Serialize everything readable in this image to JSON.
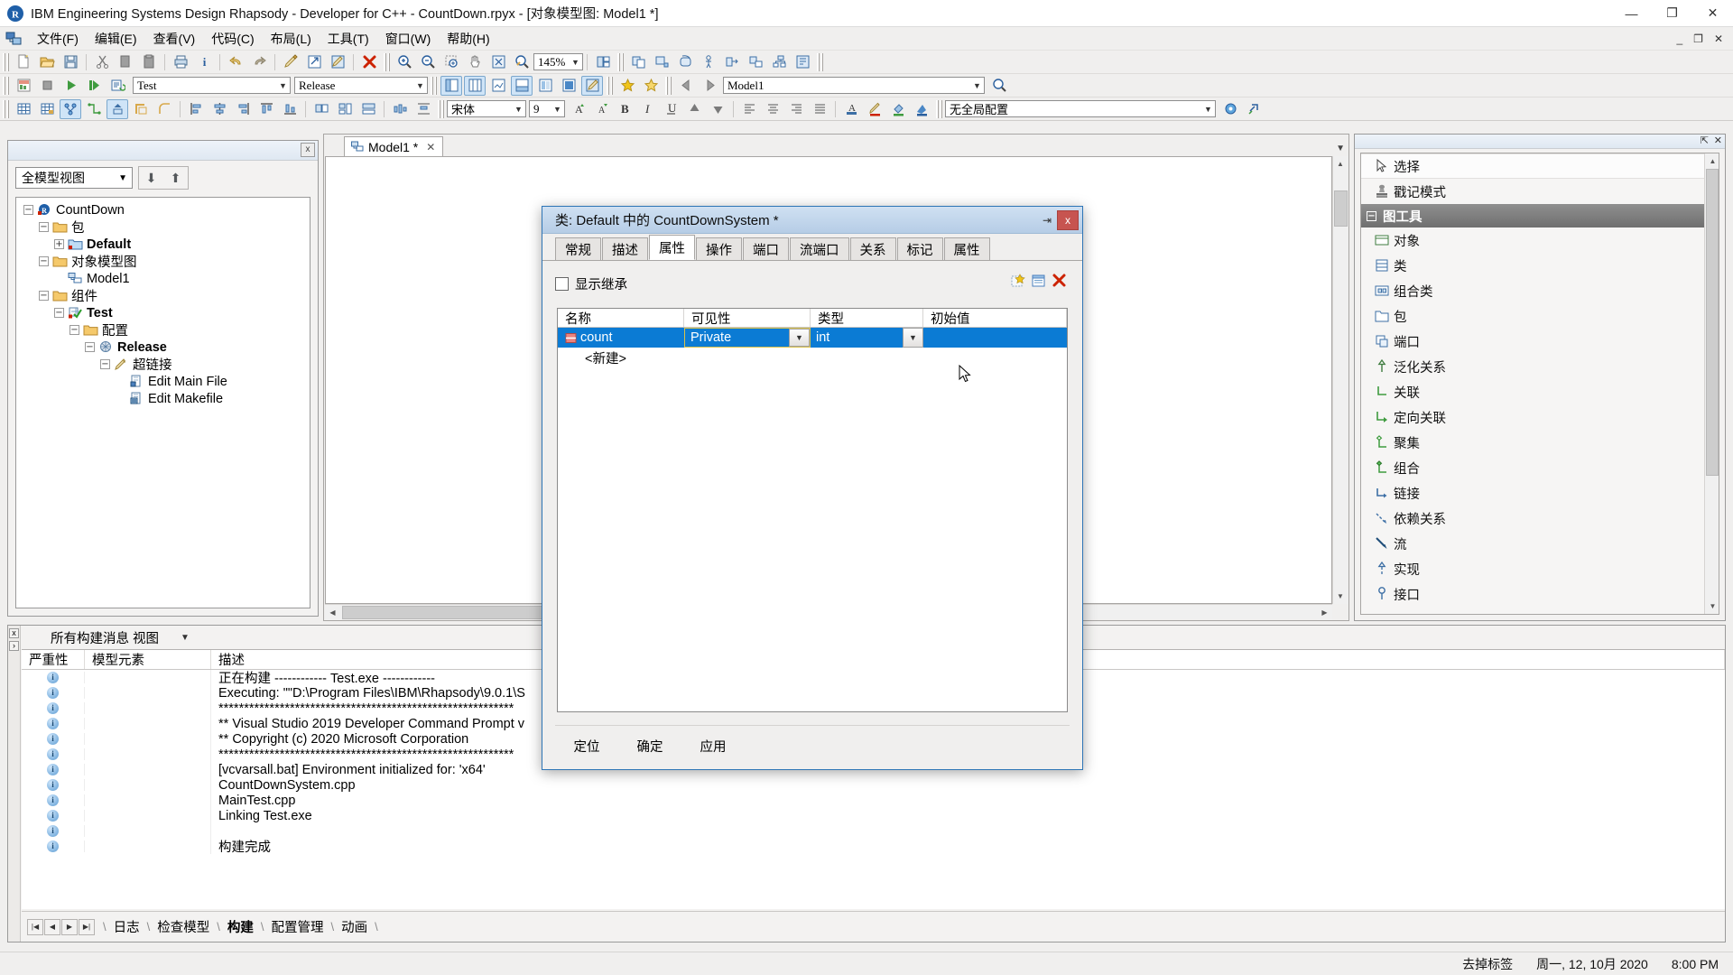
{
  "window": {
    "title": "IBM Engineering Systems Design Rhapsody - Developer for C++ - CountDown.rpyx - [对象模型图: Model1 *]",
    "minimize": "—",
    "restore": "❐",
    "close": "✕",
    "inner_minimize": "_",
    "inner_restore": "❐",
    "inner_close": "✕"
  },
  "menu": {
    "items": [
      {
        "label": "文件(F)"
      },
      {
        "label": "编辑(E)"
      },
      {
        "label": "查看(V)"
      },
      {
        "label": "代码(C)"
      },
      {
        "label": "布局(L)"
      },
      {
        "label": "工具(T)"
      },
      {
        "label": "窗口(W)"
      },
      {
        "label": "帮助(H)"
      }
    ]
  },
  "toolbar": {
    "zoom_level": "145%",
    "config_combo": "Test",
    "build_combo": "Release",
    "model_combo": "Model1",
    "font_name": "宋体",
    "font_size": "9",
    "global_config": "无全局配置"
  },
  "left_panel": {
    "view_selector": "全模型视图",
    "close": "x",
    "tree": [
      {
        "depth": 0,
        "label": "CountDown",
        "toggle": "−",
        "icon": "rhapsody-project-icon",
        "bold": false
      },
      {
        "depth": 1,
        "label": "包",
        "toggle": "−",
        "icon": "folder-icon",
        "bold": false
      },
      {
        "depth": 2,
        "label": "Default",
        "toggle": "+",
        "icon": "package-icon",
        "bold": true
      },
      {
        "depth": 1,
        "label": "对象模型图",
        "toggle": "−",
        "icon": "folder-icon",
        "bold": false
      },
      {
        "depth": 2,
        "label": "Model1",
        "toggle": "",
        "icon": "diagram-icon",
        "bold": false
      },
      {
        "depth": 1,
        "label": "组件",
        "toggle": "−",
        "icon": "folder-icon",
        "bold": false
      },
      {
        "depth": 2,
        "label": "Test",
        "toggle": "−",
        "icon": "component-icon",
        "bold": true
      },
      {
        "depth": 3,
        "label": "配置",
        "toggle": "−",
        "icon": "folder-icon",
        "bold": false
      },
      {
        "depth": 4,
        "label": "Release",
        "toggle": "−",
        "icon": "config-icon",
        "bold": true
      },
      {
        "depth": 5,
        "label": "超链接",
        "toggle": "−",
        "icon": "hyperlink-icon",
        "bold": false
      },
      {
        "depth": 6,
        "label": "Edit Main File",
        "toggle": "",
        "icon": "file-icon",
        "bold": false
      },
      {
        "depth": 6,
        "label": "Edit Makefile",
        "toggle": "",
        "icon": "makefile-icon",
        "bold": false
      }
    ]
  },
  "mdi": {
    "tab_label": "Model1 *",
    "tab_close": "✕"
  },
  "right_panel": {
    "pin": "⇱",
    "close": "✕",
    "items": [
      {
        "label": "选择",
        "icon": "arrow-cursor-icon",
        "selected": true,
        "group": false
      },
      {
        "label": "戳记模式",
        "icon": "stamp-icon",
        "selected": false,
        "group": false
      },
      {
        "label": "图工具",
        "icon": "",
        "selected": false,
        "group": true,
        "toggle": "−"
      },
      {
        "label": "对象",
        "icon": "object-icon",
        "selected": false,
        "group": false
      },
      {
        "label": "类",
        "icon": "class-icon",
        "selected": false,
        "group": false
      },
      {
        "label": "组合类",
        "icon": "composite-class-icon",
        "selected": false,
        "group": false
      },
      {
        "label": "包",
        "icon": "package-icon",
        "selected": false,
        "group": false
      },
      {
        "label": "端口",
        "icon": "port-icon",
        "selected": false,
        "group": false
      },
      {
        "label": "泛化关系",
        "icon": "generalization-icon",
        "selected": false,
        "group": false
      },
      {
        "label": "关联",
        "icon": "association-icon",
        "selected": false,
        "group": false
      },
      {
        "label": "定向关联",
        "icon": "directed-association-icon",
        "selected": false,
        "group": false
      },
      {
        "label": "聚集",
        "icon": "aggregation-icon",
        "selected": false,
        "group": false
      },
      {
        "label": "组合",
        "icon": "composition-icon",
        "selected": false,
        "group": false
      },
      {
        "label": "链接",
        "icon": "link-icon",
        "selected": false,
        "group": false
      },
      {
        "label": "依赖关系",
        "icon": "dependency-icon",
        "selected": false,
        "group": false
      },
      {
        "label": "流",
        "icon": "flow-icon",
        "selected": false,
        "group": false
      },
      {
        "label": "实现",
        "icon": "realization-icon",
        "selected": false,
        "group": false
      },
      {
        "label": "接口",
        "icon": "interface-icon",
        "selected": false,
        "group": false
      }
    ]
  },
  "dialog": {
    "title": "类: Default 中的 CountDownSystem *",
    "pin": "⇥",
    "close": "x",
    "tabs": [
      {
        "label": "常规",
        "selected": false
      },
      {
        "label": "描述",
        "selected": false
      },
      {
        "label": "属性",
        "selected": true
      },
      {
        "label": "操作",
        "selected": false
      },
      {
        "label": "端口",
        "selected": false
      },
      {
        "label": "流端口",
        "selected": false
      },
      {
        "label": "关系",
        "selected": false
      },
      {
        "label": "标记",
        "selected": false
      },
      {
        "label": "属性",
        "selected": false
      }
    ],
    "show_inherited_label": "显示继承",
    "show_inherited_checked": false,
    "row_buttons": [
      {
        "name": "add-attribute-icon",
        "glyph": "add"
      },
      {
        "name": "edit-attribute-icon",
        "glyph": "edit"
      },
      {
        "name": "delete-attribute-icon",
        "glyph": "delete"
      }
    ],
    "table": {
      "columns": [
        "名称",
        "可见性",
        "类型",
        "初始值"
      ],
      "rows": [
        {
          "name": "count",
          "visibility": "Private",
          "type": "int",
          "initial_value": "",
          "selected": true
        }
      ],
      "new_row_label": "<新建>"
    },
    "buttons": [
      {
        "label": "定位"
      },
      {
        "label": "确定"
      },
      {
        "label": "应用"
      }
    ]
  },
  "bottom_panel": {
    "view_selector": "所有构建消息 视图",
    "columns": [
      "严重性",
      "模型元素",
      "描述"
    ],
    "rows": [
      {
        "severity": "i",
        "element": "",
        "description": "正在构建 ------------ Test.exe  ------------"
      },
      {
        "severity": "i",
        "element": "",
        "description": "Executing: \"\"D:\\Program Files\\IBM\\Rhapsody\\9.0.1\\S"
      },
      {
        "severity": "i",
        "element": "",
        "description": "**********************************************************"
      },
      {
        "severity": "i",
        "element": "",
        "description": "** Visual Studio 2019 Developer Command Prompt v"
      },
      {
        "severity": "i",
        "element": "",
        "description": "** Copyright (c) 2020 Microsoft Corporation"
      },
      {
        "severity": "i",
        "element": "",
        "description": "**********************************************************"
      },
      {
        "severity": "i",
        "element": "",
        "description": "[vcvarsall.bat] Environment initialized for: 'x64'"
      },
      {
        "severity": "i",
        "element": "",
        "description": "CountDownSystem.cpp"
      },
      {
        "severity": "i",
        "element": "",
        "description": "MainTest.cpp"
      },
      {
        "severity": "i",
        "element": "",
        "description": "Linking Test.exe"
      },
      {
        "severity": "i",
        "element": "",
        "description": ""
      },
      {
        "severity": "i",
        "element": "",
        "description": "构建完成"
      }
    ],
    "tabs": [
      {
        "label": "日志",
        "selected": false
      },
      {
        "label": "检查模型",
        "selected": false
      },
      {
        "label": "构建",
        "selected": true
      },
      {
        "label": "配置管理",
        "selected": false
      },
      {
        "label": "动画",
        "selected": false
      }
    ],
    "nav_buttons": [
      "|◀",
      "◀",
      "▶",
      "▶|"
    ]
  },
  "statusbar": {
    "hint": "去掉标签",
    "date": "周一, 12, 10月 2020",
    "time": "8:00 PM"
  },
  "colors": {
    "accent": "#0b7bd4",
    "titlebar_bg": "#ffffff",
    "chrome_bg": "#f0efee",
    "dialog_titlebar": "#b6cde6",
    "close_red": "#c75450"
  }
}
